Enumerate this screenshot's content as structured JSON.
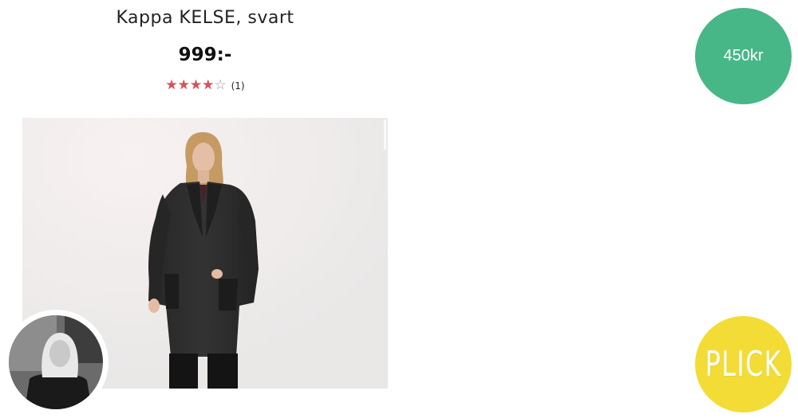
{
  "product": {
    "title": "Kappa KELSE, svart",
    "price": "999:-",
    "rating": {
      "stars_filled": 4,
      "stars_total": 5,
      "review_count": "(1)"
    }
  },
  "listing": {
    "price_bubble": "450kr"
  },
  "actions": {
    "plick_label": "PLICK"
  },
  "colors": {
    "price_bubble": "#47b787",
    "plick_button": "#f3dc35",
    "star_filled": "#d9515a",
    "star_empty": "#9a9a9a"
  }
}
